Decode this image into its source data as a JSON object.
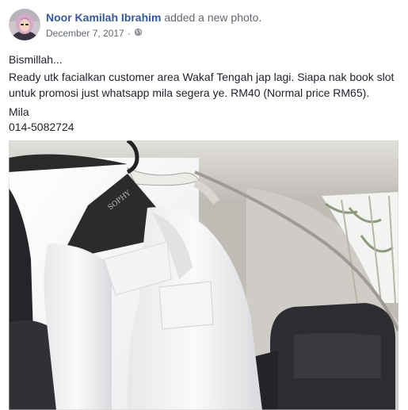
{
  "post": {
    "author_name": "Noor Kamilah Ibrahim",
    "action_text": "added a new photo.",
    "date": "December 7, 2017",
    "separator": "·",
    "privacy_icon": "globe-icon",
    "body_lines": [
      "Bismillah...",
      "Ready utk facialkan customer area Wakaf Tengah jap lagi. Siapa nak book slot",
      "untuk promosi just whatsapp mila segera ye. RM40 (Normal price RM65).",
      "Mila",
      "014-5082724"
    ],
    "photo_hanger_brand": "SOPHY"
  },
  "colors": {
    "author_link": "#365899",
    "meta_text": "#616770",
    "body_text": "#1d2129"
  }
}
